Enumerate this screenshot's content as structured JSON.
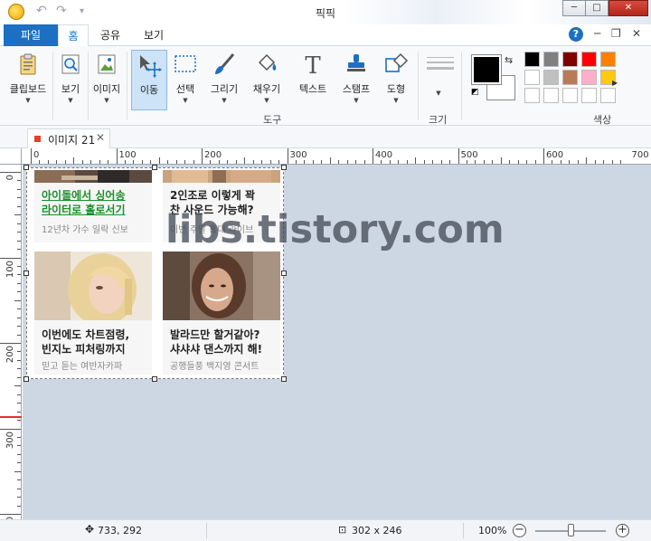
{
  "window": {
    "title": "픽픽",
    "minimize_label": "─",
    "maximize_label": "□",
    "close_label": "✕"
  },
  "quick_access": {
    "undo": "↶",
    "redo": "↷",
    "customize": "▾"
  },
  "ribbon_tabs": [
    {
      "label": "파일"
    },
    {
      "label": "홈"
    },
    {
      "label": "공유"
    },
    {
      "label": "보기"
    }
  ],
  "ribbon_controls": {
    "help": "?",
    "minimize_ribbon": "─",
    "restore": "❐",
    "close": "✕"
  },
  "ribbon": {
    "clipboard": "클립보드",
    "view": "보기",
    "image": "이미지",
    "move": "이동",
    "select": "선택",
    "draw": "그리기",
    "fill": "채우기",
    "text": "텍스트",
    "stamp": "스탬프",
    "shape": "도형",
    "tools_group": "도구",
    "size_group": "크기",
    "color_group": "색상"
  },
  "colors": {
    "primary": "#000000",
    "secondary": "#ffffff",
    "palette_row1": [
      "#000000",
      "#808080",
      "#800000",
      "#ff0000",
      "#ff8000"
    ],
    "palette_row2": [
      "#ffffff",
      "#c0c0c0",
      "#b97a57",
      "#ffaec9",
      "#ffc90e"
    ],
    "palette_row3": [
      "#ffffff",
      "#ffffff",
      "#ffffff",
      "#ffffff",
      "#ffffff"
    ],
    "accent": "#1d6fc1"
  },
  "document_tab": {
    "name": "이미지 21",
    "close": "✕"
  },
  "ruler": {
    "top_labels": [
      "0",
      "100",
      "200",
      "300",
      "400",
      "500",
      "600",
      "700"
    ],
    "left_labels": [
      "0",
      "100",
      "200",
      "300",
      "30"
    ]
  },
  "cards": [
    {
      "headline_line1": "아이돌에서 싱어송",
      "headline_line2": "라이터로 홀로서기",
      "sub": "12년차 가수 일락 신보"
    },
    {
      "headline_line1": "2인조로 이렇게 꽉",
      "headline_line2": "찬 사운드 가능해?",
      "sub": "이번 주말 홍대 라이브"
    },
    {
      "headline_line1": "이번에도 차트점령,",
      "headline_line2": "빈지노 피처링까지",
      "sub": "믿고 듣는 여반자카파"
    },
    {
      "headline_line1": "발라드만 할거같아?",
      "headline_line2": "샤샤샤 댄스까지 해!",
      "sub": "공행들풍 백지영 콘서트"
    }
  ],
  "watermark": "libs.tistory.com",
  "status": {
    "cursor": "733, 292",
    "selection": "302 x 246",
    "zoom": "100%",
    "zoom_out": "−",
    "zoom_in": "+",
    "zoom_level": 0.5
  }
}
